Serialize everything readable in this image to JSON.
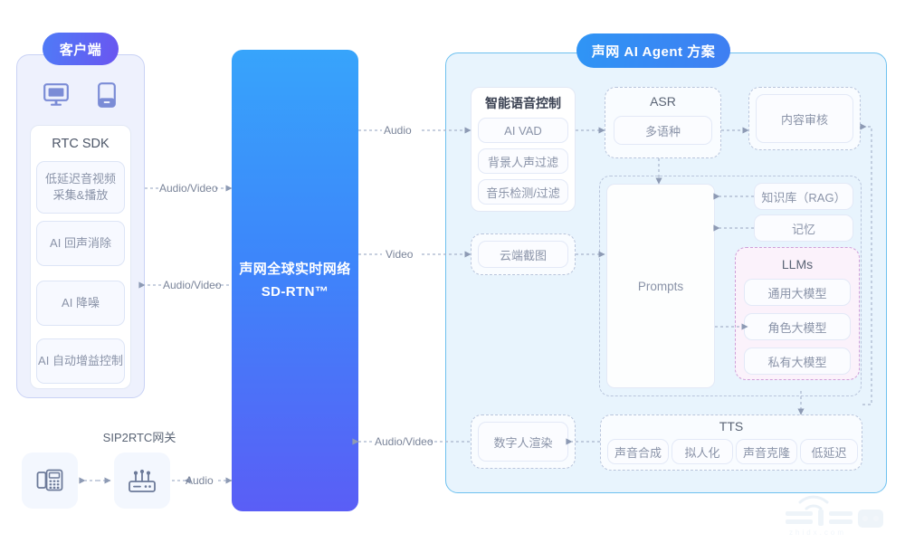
{
  "client": {
    "title": "客户端",
    "devices": [
      {
        "name": "desktop-icon"
      },
      {
        "name": "mobile-icon"
      }
    ],
    "sdk": {
      "title": "RTC SDK",
      "items": [
        "低延迟音视频\n采集&播放",
        "AI 回声消除",
        "AI 降噪",
        "AI 自动增益控制"
      ]
    },
    "gateway": {
      "title": "SIP2RTC网关",
      "phone_icon": "desk-phone-icon",
      "router_icon": "router-icon"
    }
  },
  "network": {
    "line1": "声网全球实时网络",
    "line2": "SD-RTN™"
  },
  "agent": {
    "title": "声网 AI Agent 方案",
    "voice_control": {
      "title": "智能语音控制",
      "items": [
        "AI VAD",
        "背景人声过滤",
        "音乐检测/过滤"
      ]
    },
    "screenshot": {
      "label": "云端截图"
    },
    "asr": {
      "title": "ASR",
      "items": [
        "多语种"
      ]
    },
    "moderation": {
      "label": "内容审核"
    },
    "prompts": {
      "label": "Prompts"
    },
    "knowledge": [
      {
        "label": "知识库（RAG）"
      },
      {
        "label": "记忆"
      }
    ],
    "llms": {
      "title": "LLMs",
      "items": [
        "通用大模型",
        "角色大模型",
        "私有大模型"
      ]
    },
    "avatar": {
      "label": "数字人渲染"
    },
    "tts": {
      "title": "TTS",
      "items": [
        "声音合成",
        "拟人化",
        "声音克隆",
        "低延迟"
      ]
    }
  },
  "connectors": {
    "client_av_top": "Audio/Video",
    "client_av_bottom": "Audio/Video",
    "gateway_audio": "Audio",
    "rtn_audio": "Audio",
    "rtn_video": "Video",
    "rtn_av_bottom": "Audio/Video"
  },
  "watermark": {
    "brand": "智东西",
    "domain": "zhidx.com"
  },
  "colors": {
    "client_accent": "#5a6bf0",
    "agent_accent": "#3a92f3",
    "llm_accent": "#cf9fd8",
    "line": "#a8b4cc"
  }
}
